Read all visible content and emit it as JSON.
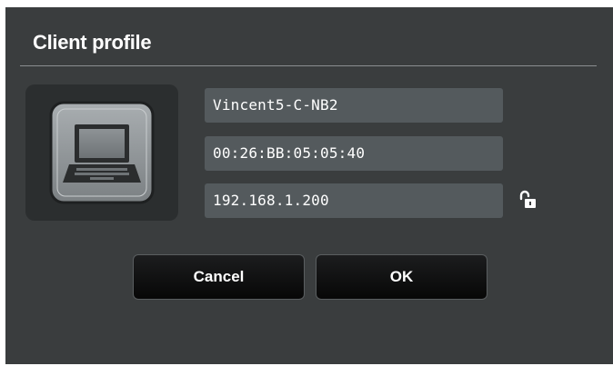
{
  "dialog": {
    "title": "Client profile"
  },
  "device": {
    "icon": "laptop-icon"
  },
  "fields": {
    "name": "Vincent5-C-NB2",
    "mac": "00:26:BB:05:05:40",
    "ip": "192.168.1.200",
    "ip_lock_icon": "unlocked-padlock-icon"
  },
  "buttons": {
    "cancel_label": "Cancel",
    "ok_label": "OK"
  },
  "colors": {
    "dialog_bg": "#3a3d3e",
    "field_bg": "#545a5d",
    "tile_bg": "#2b2e2f",
    "text": "#ffffff"
  }
}
